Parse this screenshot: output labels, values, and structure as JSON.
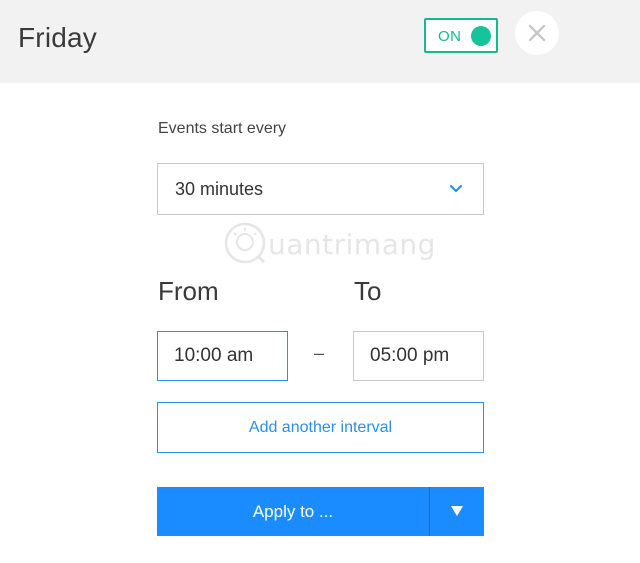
{
  "header": {
    "title": "Friday",
    "toggle": {
      "label": "ON",
      "state": "on",
      "color": "#17b890"
    },
    "close_icon": "close-icon"
  },
  "schedule": {
    "events_label": "Events start every",
    "interval": {
      "selected": "30 minutes",
      "icon": "chevron-down-icon"
    },
    "from_label": "From",
    "to_label": "To",
    "from_time": "10:00 am",
    "separator": "–",
    "to_time": "05:00 pm",
    "add_interval_label": "Add another interval"
  },
  "apply": {
    "label": "Apply to ...",
    "dropdown_icon": "caret-down-icon",
    "color": "#1a8cff"
  },
  "watermark": {
    "text": "uantrimang"
  }
}
